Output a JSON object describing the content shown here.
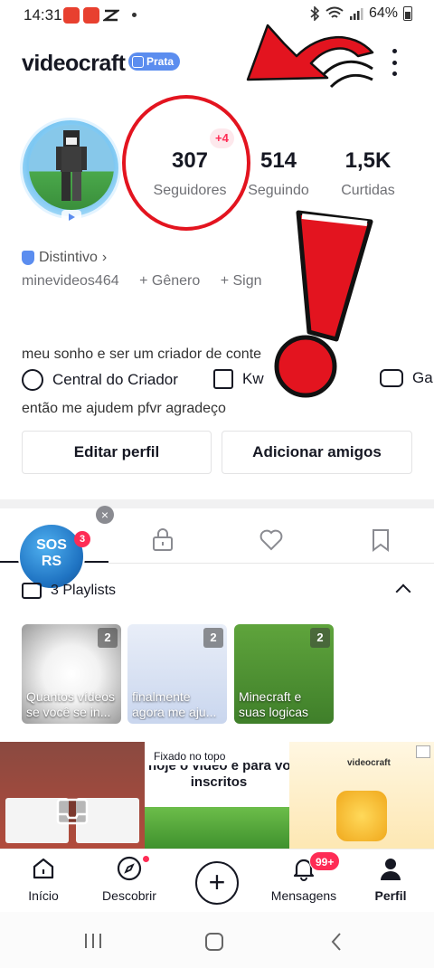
{
  "status_bar": {
    "time": "14:31",
    "battery": "64%",
    "icons": [
      "capcut-icon",
      "capcut-icon",
      "capcut-icon",
      "bluetooth-icon",
      "wifi-icon",
      "signal-icon",
      "battery-icon"
    ]
  },
  "header": {
    "username": "videocraft",
    "badge": "Prata",
    "menu_icon": "more-vertical-icon"
  },
  "profile": {
    "stats": [
      {
        "value": "307",
        "label": "Seguidores",
        "delta": "+4"
      },
      {
        "value": "514",
        "label": "Seguindo"
      },
      {
        "value": "1,5K",
        "label": "Curtidas"
      }
    ],
    "distintivo": "Distintivo",
    "handle": "minevideos464",
    "gender": "+ Gênero",
    "sign": "+ Sign",
    "bio_line1": "meu sonho e ser um criador de conte",
    "bio_line2": "então me ajudem pfvr agradeço"
  },
  "tools": {
    "creator": "Central do Criador",
    "shop": "Kw",
    "games": "Ga"
  },
  "buttons": {
    "edit": "Editar perfil",
    "add_friends": "Adicionar amigos"
  },
  "story": {
    "title": "SOS\nRS",
    "count": "3",
    "close": "×"
  },
  "playlists": {
    "label": "3 Playlists",
    "items": [
      {
        "title": "Quantos vídeos\nse você se in...",
        "count": "2"
      },
      {
        "title": "finalmente\nagora me aju...",
        "count": "2"
      },
      {
        "title": "Minecraft e\nsuas logicas",
        "count": "2"
      }
    ]
  },
  "videos": {
    "pinned_label": "Fixado no topo",
    "video2_caption": "hoje o vídeo e para vo\ninscritos",
    "video3_brand": "videocraft"
  },
  "bottom_nav": {
    "home": "Início",
    "discover": "Descobrir",
    "create": "+",
    "messages": "Mensagens",
    "messages_badge": "99+",
    "profile": "Perfil"
  },
  "colors": {
    "accent_red": "#fe2c55",
    "annotation_red": "#e3141f",
    "badge_blue": "#5b8def"
  }
}
